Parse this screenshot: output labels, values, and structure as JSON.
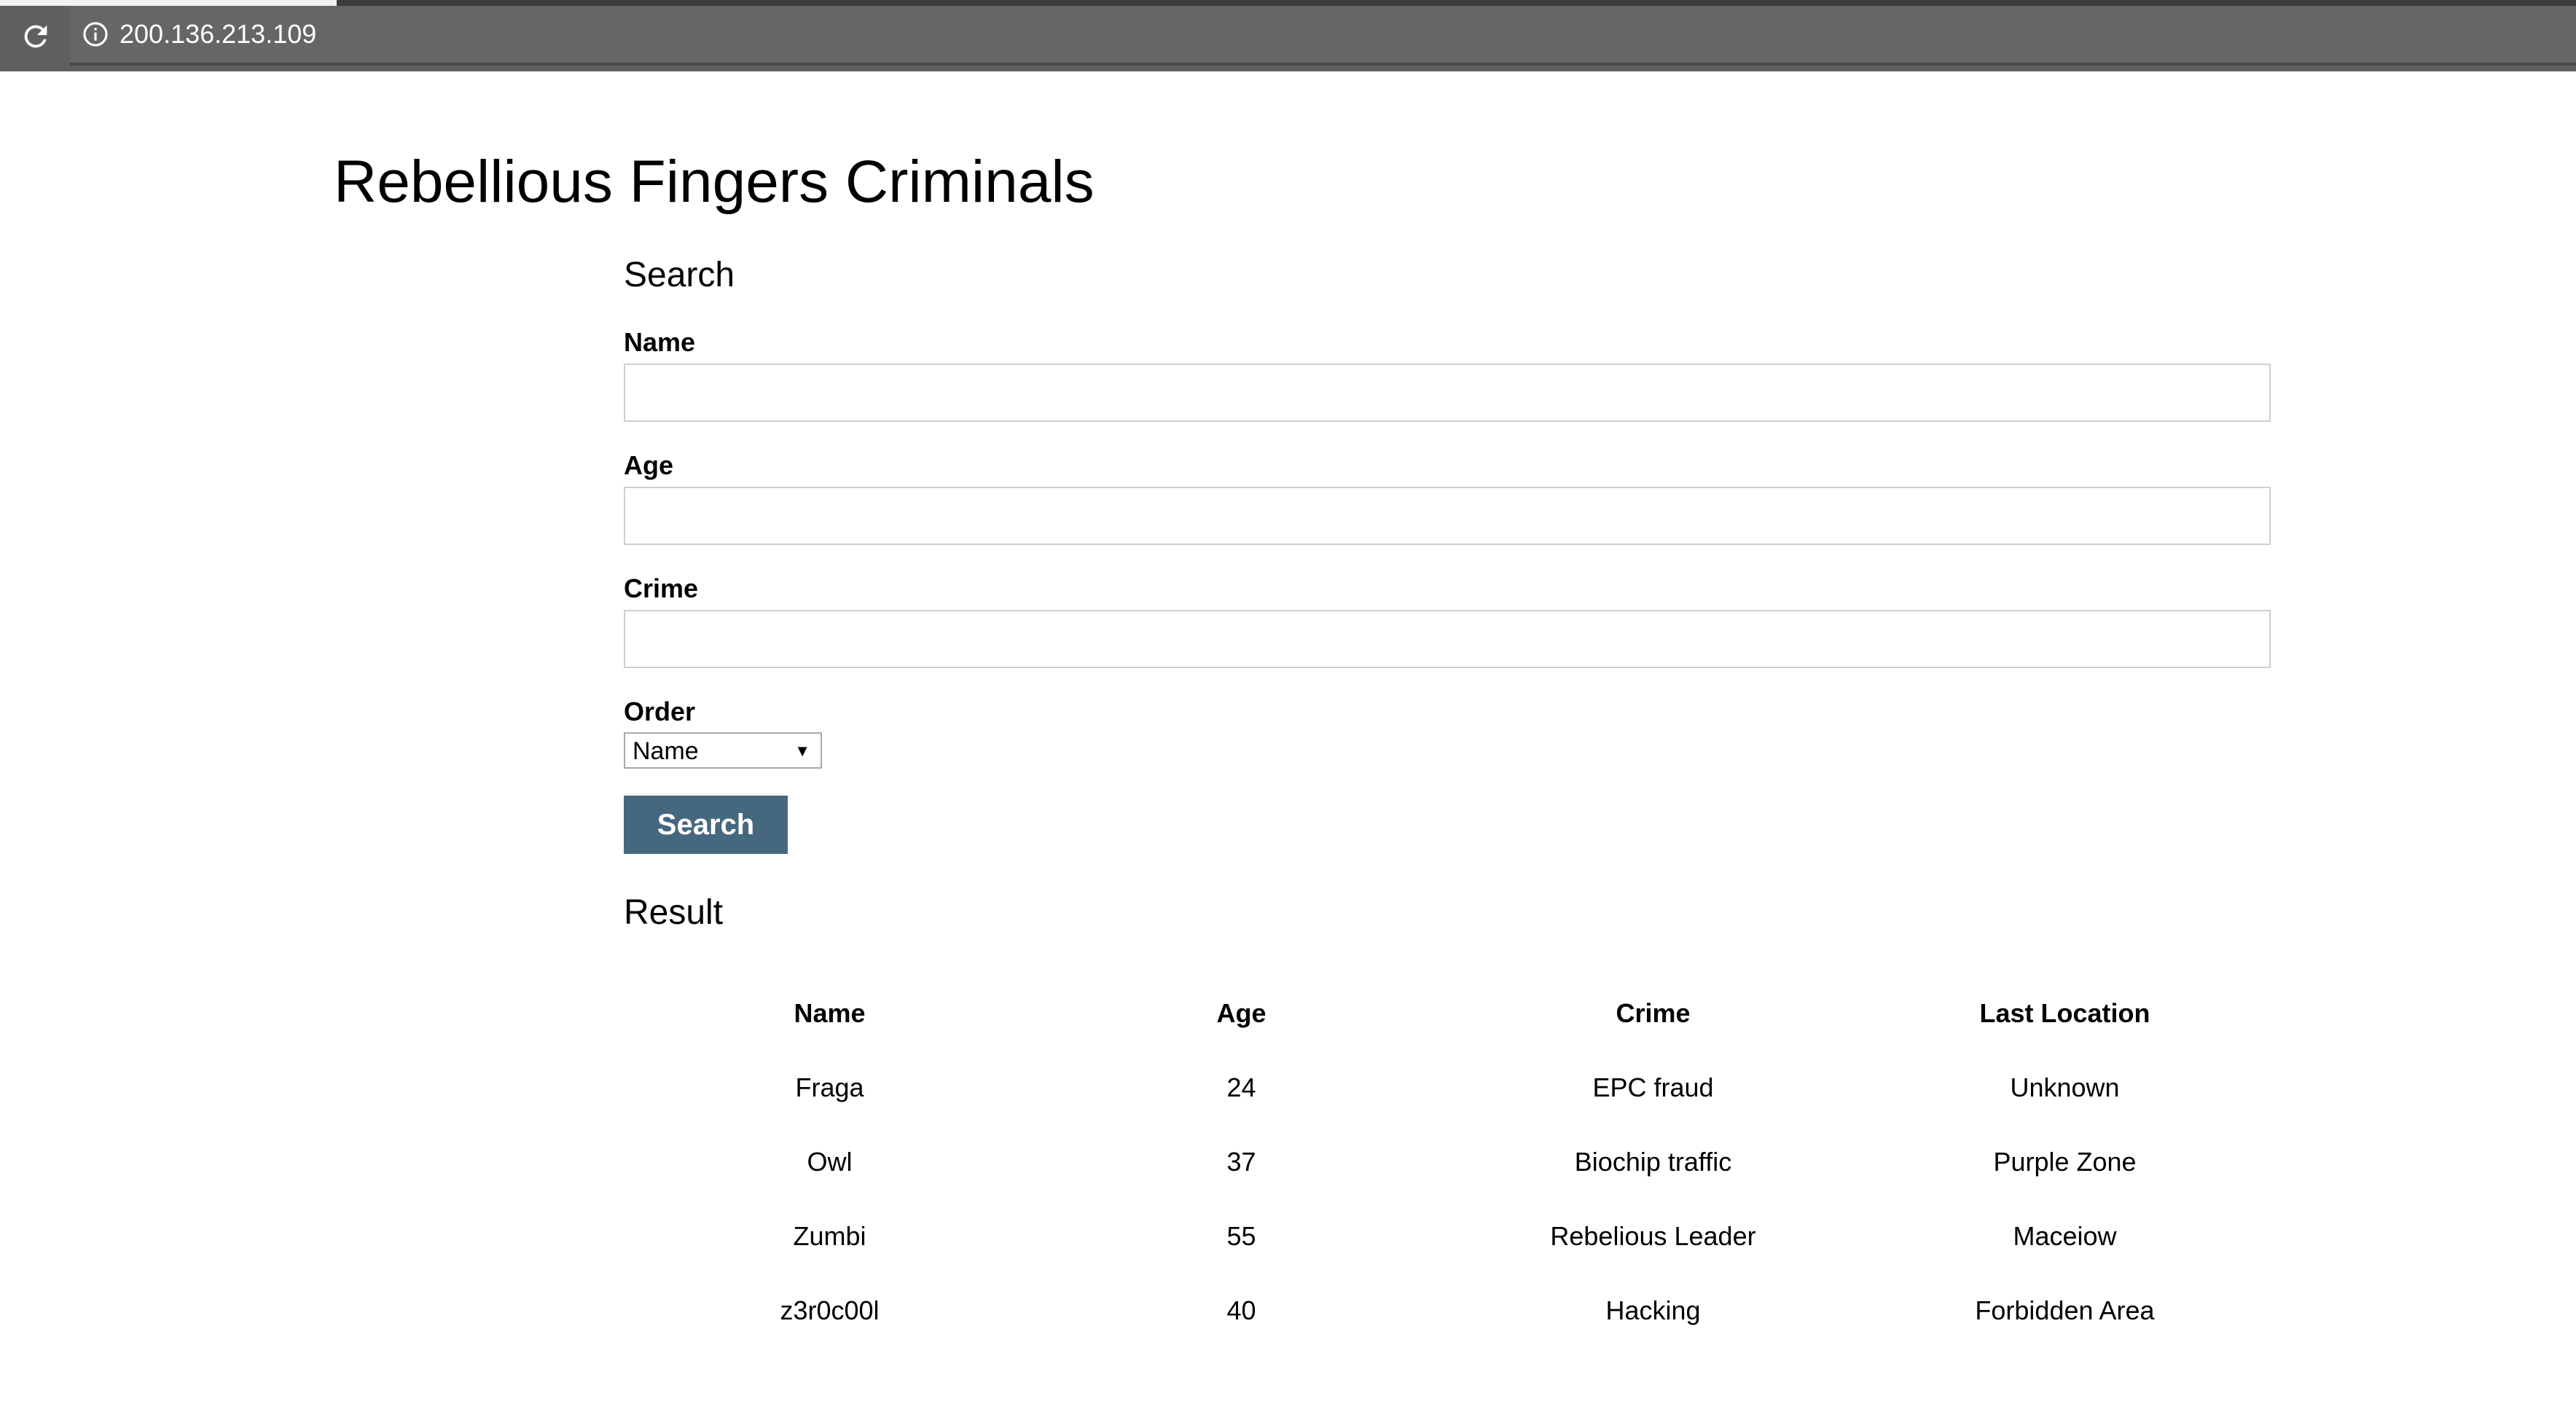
{
  "browser": {
    "url": "200.136.213.109",
    "reload_icon": "reload-icon",
    "info_icon": "info-icon"
  },
  "page": {
    "title": "Rebellious Fingers Criminals"
  },
  "search": {
    "heading": "Search",
    "name_label": "Name",
    "name_value": "",
    "age_label": "Age",
    "age_value": "",
    "crime_label": "Crime",
    "crime_value": "",
    "order_label": "Order",
    "order_selected": "Name",
    "button_label": "Search"
  },
  "result": {
    "heading": "Result",
    "columns": [
      "Name",
      "Age",
      "Crime",
      "Last Location"
    ],
    "rows": [
      [
        "Fraga",
        "24",
        "EPC fraud",
        "Unknown"
      ],
      [
        "Owl",
        "37",
        "Biochip traffic",
        "Purple Zone"
      ],
      [
        "Zumbi",
        "55",
        "Rebelious Leader",
        "Maceiow"
      ],
      [
        "z3r0c00l",
        "40",
        "Hacking",
        "Forbidden Area"
      ]
    ]
  },
  "colors": {
    "browser_bar": "#5f5f5f",
    "button": "#45687e",
    "input_border": "#cfcfcf"
  }
}
